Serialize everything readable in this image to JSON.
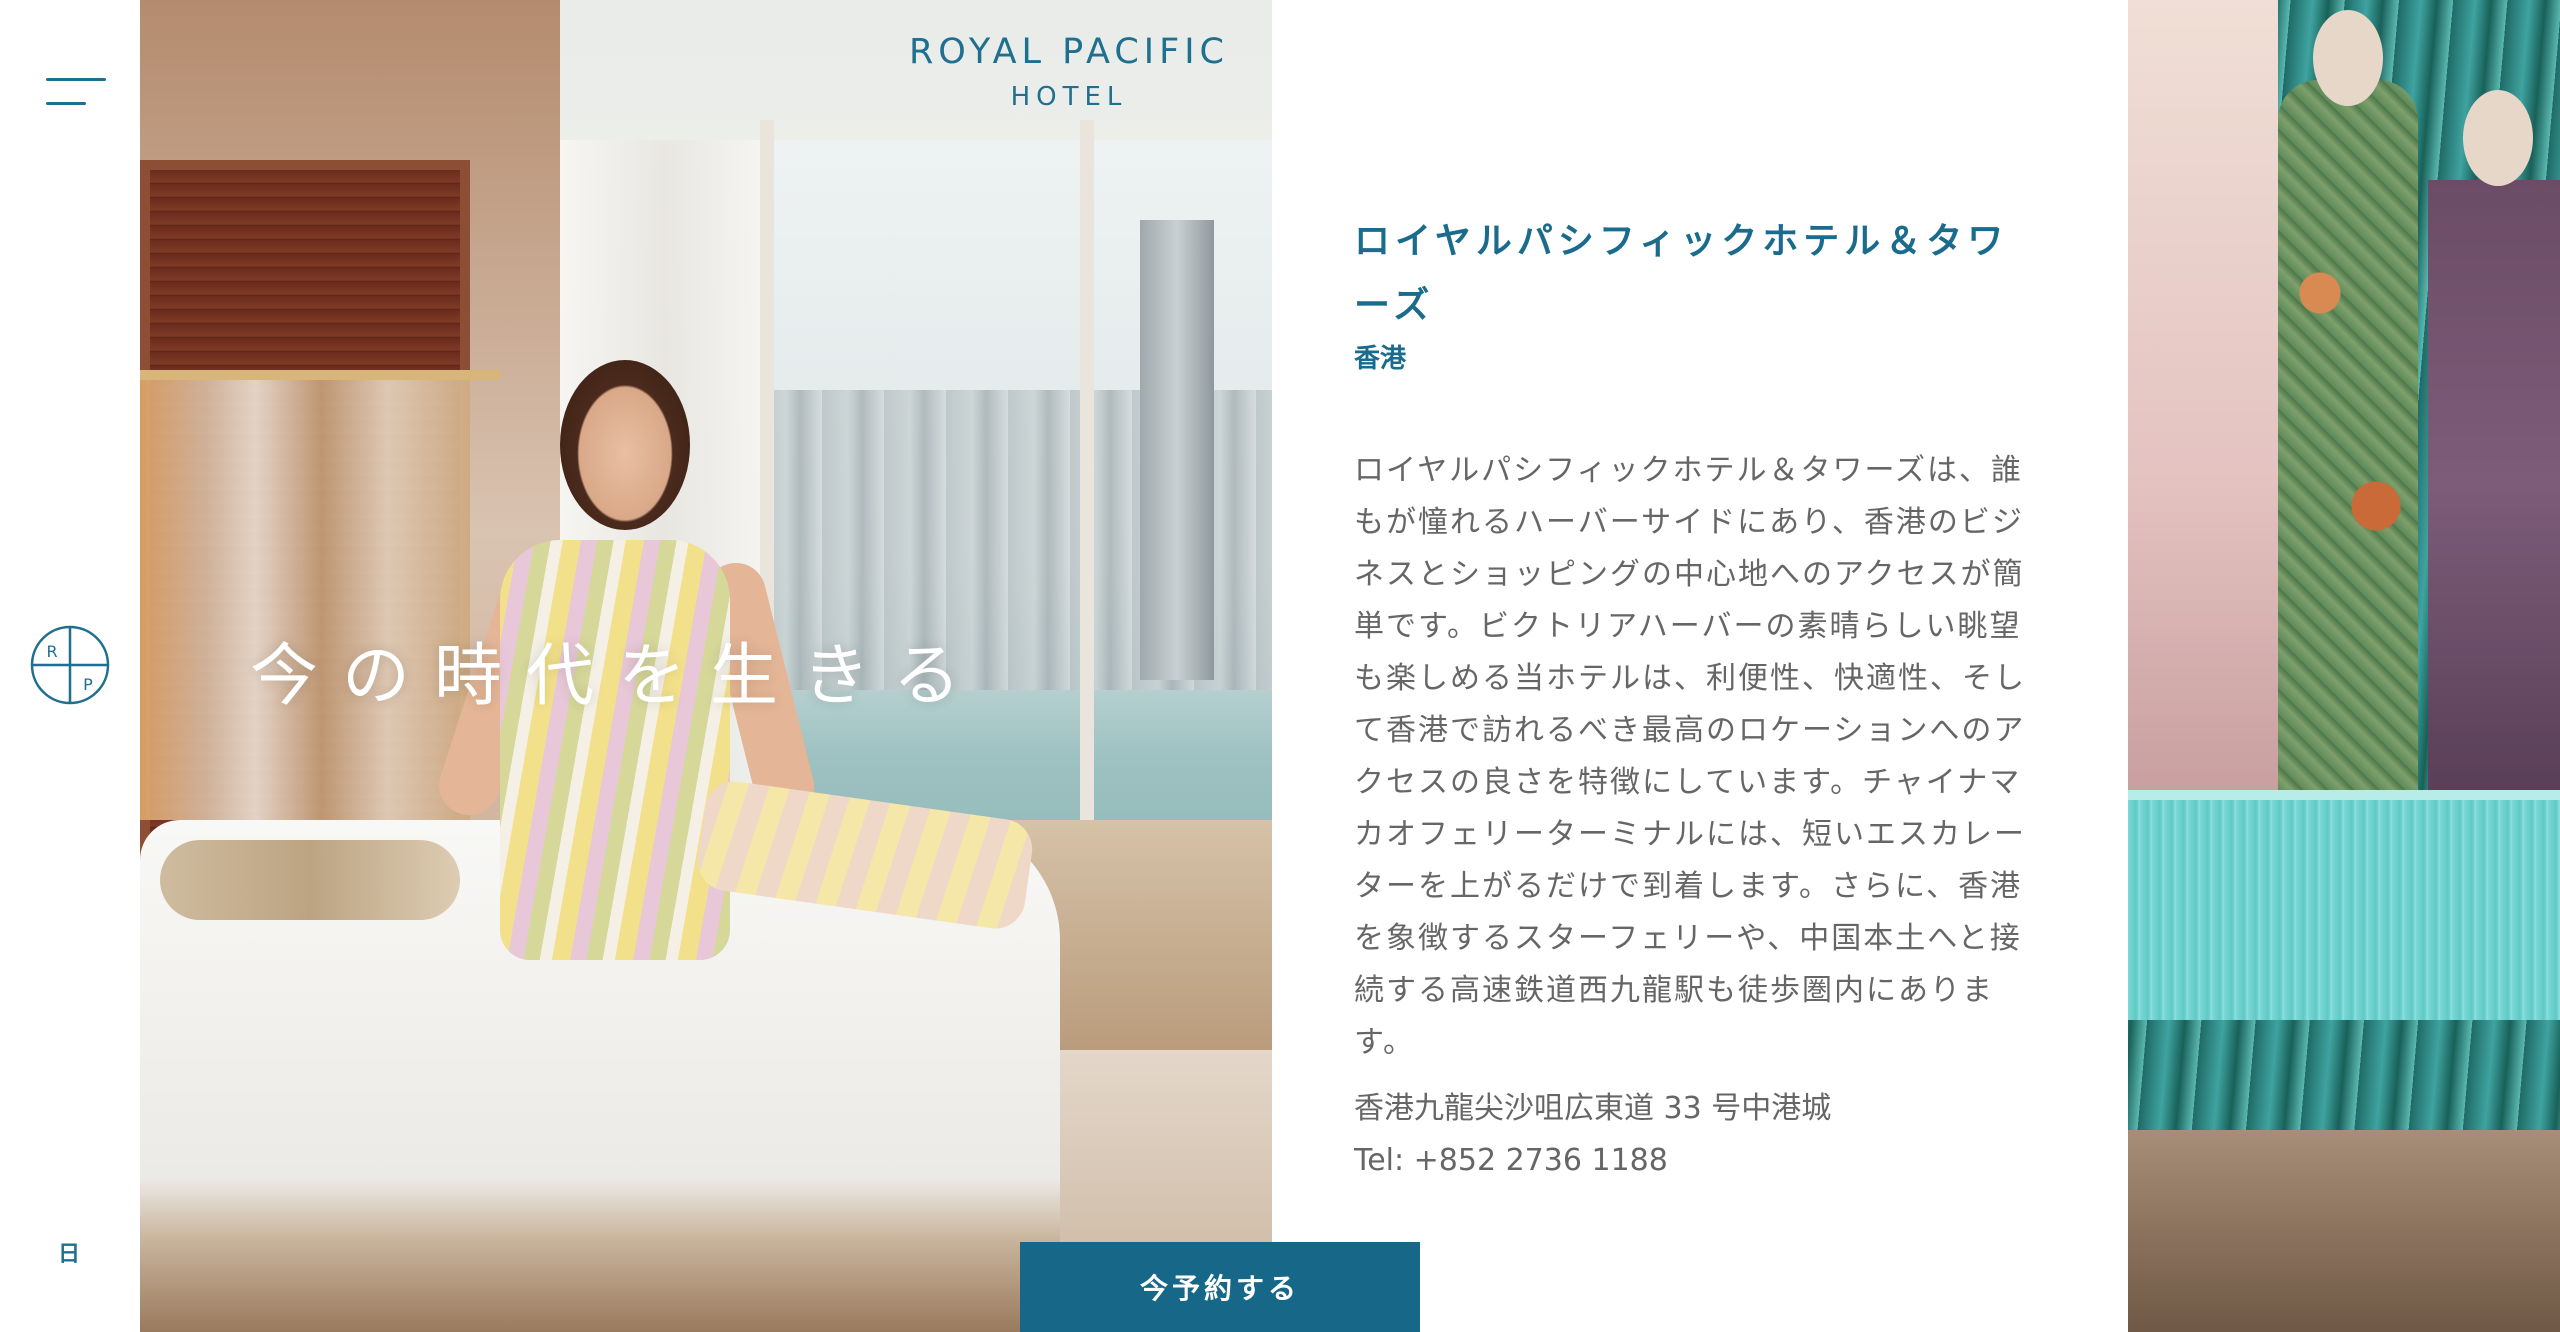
{
  "brand": {
    "name": "ROYAL PACIFIC",
    "sub": "HOTEL"
  },
  "sidebar": {
    "logo_letters": [
      "R",
      "P"
    ],
    "language_label": "日"
  },
  "hero": {
    "headline": "今の時代を生きる"
  },
  "content": {
    "title": "ロイヤルパシフィックホテル＆タワーズ",
    "city": "香港",
    "description": "ロイヤルパシフィックホテル＆タワーズは、誰もが憧れるハーバーサイドにあり、香港のビジネスとショッピングの中心地へのアクセスが簡単です。ビクトリアハーバーの素晴らしい眺望も楽しめる当ホテルは、利便性、快適性、そして香港で訪れるべき最高のロケーションへのアクセスの良さを特徴にしています。チャイナマカオフェリーターミナルには、短いエスカレーターを上がるだけで到着します。さらに、香港を象徴するスターフェリーや、中国本土へと接続する高速鉄道西九龍駅も徒歩圏内にあります。",
    "address": "香港九龍尖沙咀広東道 33 号中港城",
    "tel": "Tel: +852 2736 1188"
  },
  "actions": {
    "book_label": "今予約する"
  },
  "colors": {
    "accent": "#1a6b8c",
    "button": "#176888",
    "body_text": "#666666"
  },
  "icons": {
    "menu": "hamburger-menu-icon",
    "logo": "rp-monogram-icon"
  }
}
